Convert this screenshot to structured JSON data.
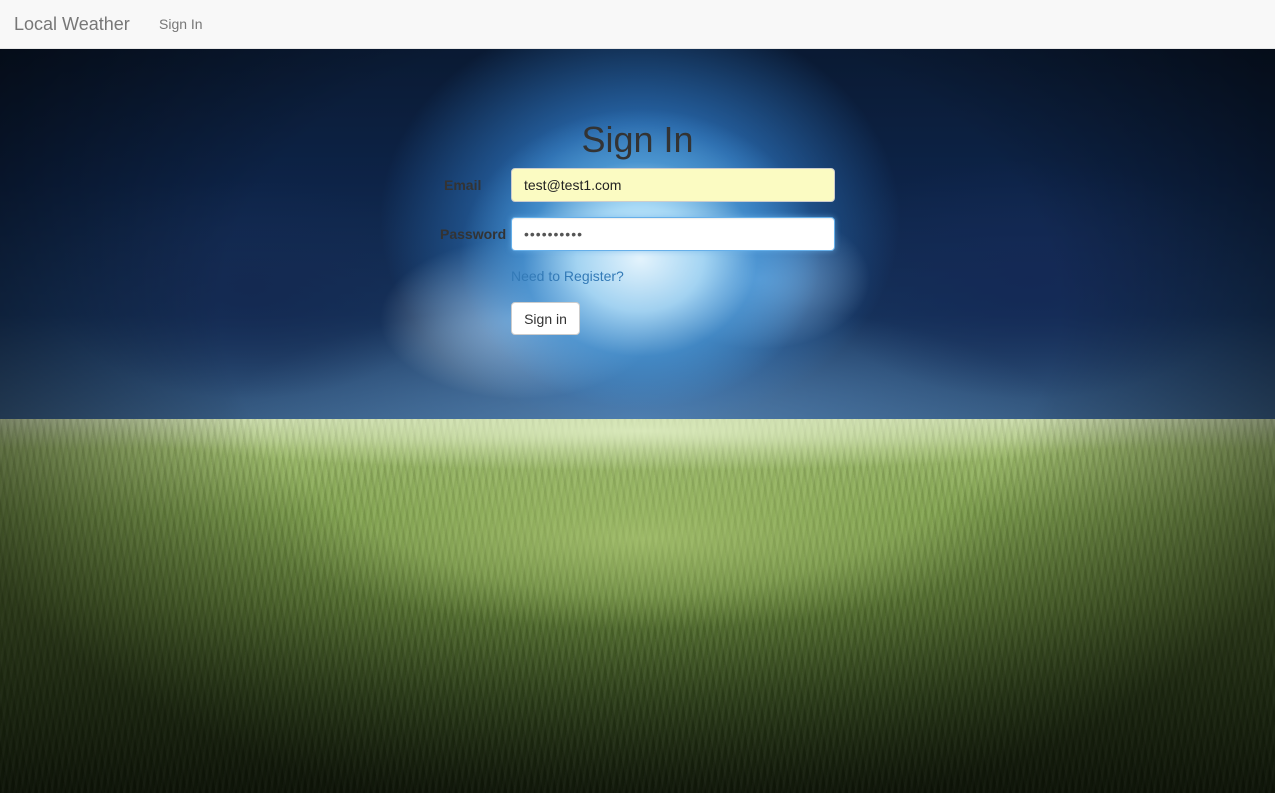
{
  "navbar": {
    "brand": "Local Weather",
    "links": [
      {
        "label": "Sign In"
      }
    ]
  },
  "form": {
    "title": "Sign In",
    "email": {
      "label": "Email",
      "value": "test@test1.com"
    },
    "password": {
      "label": "Password",
      "value": "••••••••••"
    },
    "register_link": "Need to Register?",
    "submit_label": "Sign in"
  },
  "colors": {
    "navbar_bg": "#f8f8f8",
    "link": "#337ab7",
    "autofill_bg": "#fbfbc2",
    "focus_border": "#66afe9"
  },
  "background_image": "stormy-sky-over-wheat-field"
}
